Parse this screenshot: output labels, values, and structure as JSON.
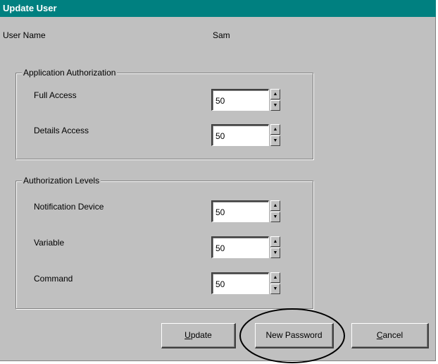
{
  "window": {
    "title": "Update User"
  },
  "user": {
    "label": "User Name",
    "value": "Sam"
  },
  "app_auth": {
    "title": "Application Authorization",
    "fields": [
      {
        "label": "Full Access",
        "value": "50"
      },
      {
        "label": "Details Access",
        "value": "50"
      }
    ]
  },
  "auth_levels": {
    "title": "Authorization Levels",
    "fields": [
      {
        "label": "Notification Device",
        "value": "50"
      },
      {
        "label": "Variable",
        "value": "50"
      },
      {
        "label": "Command",
        "value": "50"
      }
    ]
  },
  "buttons": {
    "update": {
      "mnemonic": "U",
      "rest": "pdate"
    },
    "new_password": "New Password",
    "cancel": {
      "mnemonic": "C",
      "rest": "ancel"
    }
  },
  "colors": {
    "titlebar": "#008080",
    "face": "#c0c0c0",
    "annotation": "#000000"
  }
}
